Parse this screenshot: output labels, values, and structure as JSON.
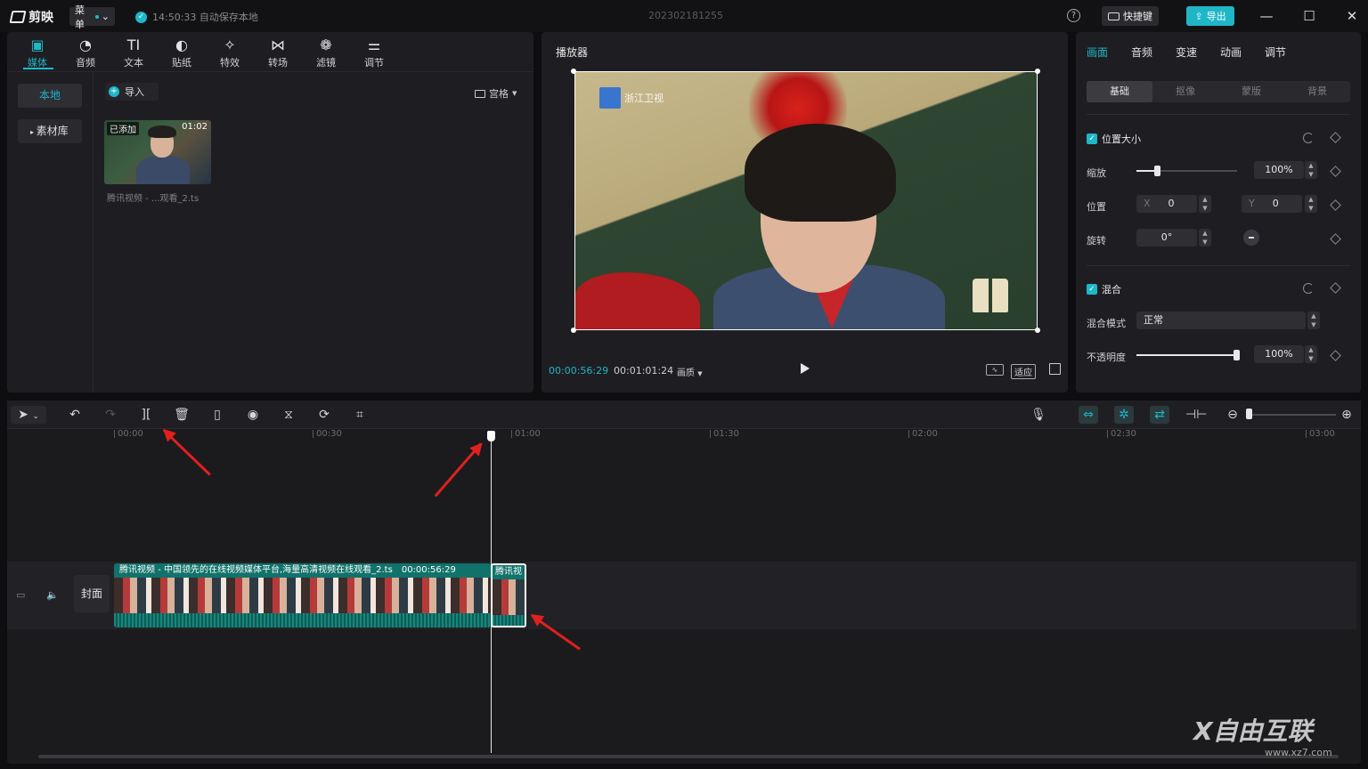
{
  "titlebar": {
    "app_name": "剪映",
    "menu_label": "菜单",
    "autosave_text": "14:50:33 自动保存本地",
    "project_name": "202302181255",
    "help_label": "?",
    "shortcut_label": "快捷键",
    "export_label": "导出",
    "min_glyph": "—",
    "max_glyph": "☐",
    "close_glyph": "✕"
  },
  "media_panel": {
    "tabs": [
      {
        "label": "媒体",
        "icon": "media-icon",
        "glyph": "▣"
      },
      {
        "label": "音频",
        "icon": "audio-icon",
        "glyph": "◔"
      },
      {
        "label": "文本",
        "icon": "text-icon",
        "glyph": "TI"
      },
      {
        "label": "贴纸",
        "icon": "sticker-icon",
        "glyph": "◐"
      },
      {
        "label": "特效",
        "icon": "effects-icon",
        "glyph": "✧"
      },
      {
        "label": "转场",
        "icon": "transition-icon",
        "glyph": "⋈"
      },
      {
        "label": "滤镜",
        "icon": "filter-icon",
        "glyph": "❁"
      },
      {
        "label": "调节",
        "icon": "adjust-icon",
        "glyph": "⚌"
      }
    ],
    "side": {
      "local": "本地",
      "library": "素材库"
    },
    "import_label": "导入",
    "view_label": "宫格",
    "clip": {
      "badge": "已添加",
      "duration": "01:02",
      "name": "腾讯视频 - ...观看_2.ts"
    }
  },
  "player": {
    "title": "播放器",
    "current_time": "00:00:56:29",
    "total_time": "00:01:01:24",
    "quality_label": "画质",
    "fit_label": "适应",
    "logo_text": "浙江卫视"
  },
  "properties": {
    "tabs": [
      "画面",
      "音频",
      "变速",
      "动画",
      "调节"
    ],
    "subtabs": [
      "基础",
      "抠像",
      "蒙版",
      "背景"
    ],
    "position_section": "位置大小",
    "scale_label": "缩放",
    "scale_value": "100%",
    "scale_fraction": 0.2,
    "pos_label": "位置",
    "x_label": "X",
    "x_value": "0",
    "y_label": "Y",
    "y_value": "0",
    "rotate_label": "旋转",
    "rotate_value": "0°",
    "blend_section": "混合",
    "blend_mode_label": "混合模式",
    "blend_mode_value": "正常",
    "opacity_label": "不透明度",
    "opacity_value": "100%",
    "opacity_fraction": 1.0
  },
  "timeline": {
    "ruler_ticks": [
      "00:00",
      "00:30",
      "01:00",
      "01:30",
      "02:00",
      "02:30",
      "03:00"
    ],
    "cover_label": "封面",
    "clip_title": "腾讯视频 - 中国领先的在线视频媒体平台,海量高清视频在线观看_2.ts",
    "clip_duration": "00:00:56:29",
    "clip2_title": "腾讯视"
  },
  "watermark": {
    "brand": "X自由互联",
    "url": "www.xz7.com"
  },
  "colors": {
    "accent": "#1fb6c8",
    "annotation_arrow": "#e0201d",
    "clip": "#0f5e58"
  }
}
